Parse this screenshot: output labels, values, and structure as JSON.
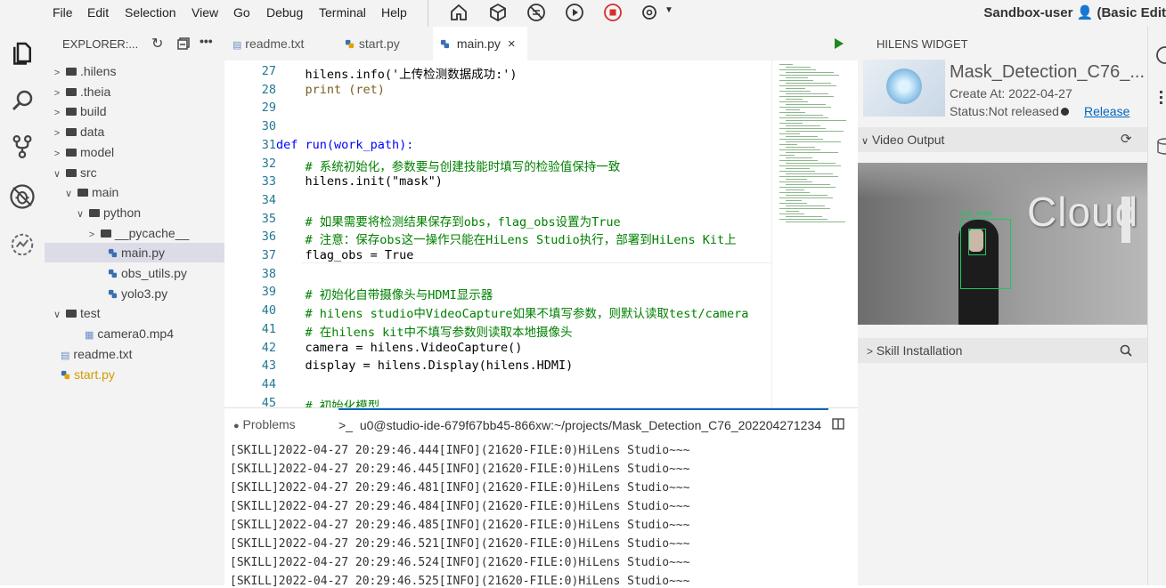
{
  "menubar": {
    "items": [
      "File",
      "Edit",
      "Selection",
      "View",
      "Go",
      "Debug",
      "Terminal",
      "Help"
    ],
    "user": "Sandbox-user",
    "edition": "(Basic Edit"
  },
  "explorer": {
    "title": "EXPLORER:...",
    "tree": [
      {
        "label": ".hilens",
        "type": "folder",
        "expanded": false,
        "depth": 0
      },
      {
        "label": ".theia",
        "type": "folder",
        "expanded": false,
        "depth": 0
      },
      {
        "label": "build",
        "type": "folder",
        "expanded": false,
        "depth": 0
      },
      {
        "label": "data",
        "type": "folder",
        "expanded": false,
        "depth": 0
      },
      {
        "label": "model",
        "type": "folder",
        "expanded": false,
        "depth": 0
      },
      {
        "label": "src",
        "type": "folder",
        "expanded": true,
        "depth": 0
      },
      {
        "label": "main",
        "type": "folder",
        "expanded": true,
        "depth": 1
      },
      {
        "label": "python",
        "type": "folder",
        "expanded": true,
        "depth": 2
      },
      {
        "label": "__pycache__",
        "type": "folder",
        "expanded": false,
        "depth": 3
      },
      {
        "label": "main.py",
        "type": "py",
        "depth": 3,
        "selected": true
      },
      {
        "label": "obs_utils.py",
        "type": "py",
        "depth": 3
      },
      {
        "label": "yolo3.py",
        "type": "py",
        "depth": 3
      },
      {
        "label": "test",
        "type": "folder",
        "expanded": true,
        "depth": 0
      },
      {
        "label": "camera0.mp4",
        "type": "video",
        "depth": 1
      },
      {
        "label": "readme.txt",
        "type": "txt",
        "depth": 0
      },
      {
        "label": "start.py",
        "type": "py-warn",
        "depth": 0
      }
    ]
  },
  "tabs": [
    {
      "label": "readme.txt",
      "icon": "text-file-icon"
    },
    {
      "label": "start.py",
      "icon": "python-file-icon"
    },
    {
      "label": "main.py",
      "icon": "python-file-icon",
      "active": true,
      "close": "×"
    }
  ],
  "editor": {
    "lines": [
      {
        "n": "27",
        "code": "    hilens.info('上传检测数据成功:')"
      },
      {
        "n": "28",
        "code": "    print (ret)"
      },
      {
        "n": "29",
        "code": ""
      },
      {
        "n": "30",
        "code": ""
      },
      {
        "n": "31",
        "code": "def run(work_path):"
      },
      {
        "n": "32",
        "code": "    # 系统初始化，参数要与创建技能时填写的检验值保持一致"
      },
      {
        "n": "33",
        "code": "    hilens.init(\"mask\")"
      },
      {
        "n": "34",
        "code": ""
      },
      {
        "n": "35",
        "code": "    # 如果需要将检测结果保存到obs，flag_obs设置为True"
      },
      {
        "n": "36",
        "code": "    # 注意：保存obs这一操作只能在HiLens Studio执行，部署到HiLens Kit上"
      },
      {
        "n": "37",
        "code": "    flag_obs = True"
      },
      {
        "n": "38",
        "code": ""
      },
      {
        "n": "39",
        "code": "    # 初始化自带摄像头与HDMI显示器"
      },
      {
        "n": "40",
        "code": "    # hilens studio中VideoCapture如果不填写参数，则默认读取test/camera"
      },
      {
        "n": "41",
        "code": "    # 在hilens kit中不填写参数则读取本地摄像头"
      },
      {
        "n": "42",
        "code": "    camera = hilens.VideoCapture()"
      },
      {
        "n": "43",
        "code": "    display = hilens.Display(hilens.HDMI)"
      },
      {
        "n": "44",
        "code": ""
      },
      {
        "n": "45",
        "code": "    # 初始化模型"
      }
    ]
  },
  "panel": {
    "problems_tab": "Problems",
    "terminal_tab": "u0@studio-ide-679f67bb45-866xw:~/projects/Mask_Detection_C76_202204271234",
    "terminal_prompt": ">_",
    "lines": [
      "[SKILL]2022-04-27 20:29:46.444[INFO](21620-FILE:0)HiLens Studio~~~",
      "[SKILL]2022-04-27 20:29:46.445[INFO](21620-FILE:0)HiLens Studio~~~",
      "[SKILL]2022-04-27 20:29:46.481[INFO](21620-FILE:0)HiLens Studio~~~",
      "[SKILL]2022-04-27 20:29:46.484[INFO](21620-FILE:0)HiLens Studio~~~",
      "[SKILL]2022-04-27 20:29:46.485[INFO](21620-FILE:0)HiLens Studio~~~",
      "[SKILL]2022-04-27 20:29:46.521[INFO](21620-FILE:0)HiLens Studio~~~",
      "[SKILL]2022-04-27 20:29:46.524[INFO](21620-FILE:0)HiLens Studio~~~",
      "[SKILL]2022-04-27 20:29:46.525[INFO](21620-FILE:0)HiLens Studio~~~"
    ]
  },
  "widget": {
    "title": "HILENS WIDGET",
    "skill_name": "Mask_Detection_C76_...",
    "create_at": "Create At: 2022-04-27",
    "status": "Status:Not released",
    "release_link": "Release",
    "video_section": "Video Output",
    "video_text": "Cloud",
    "detection_label": "has_mask",
    "skill_install_section": "Skill Installation"
  },
  "colors": {
    "accent": "#0066bf",
    "run": "#1e8a1e",
    "stop": "#d32f2f"
  }
}
